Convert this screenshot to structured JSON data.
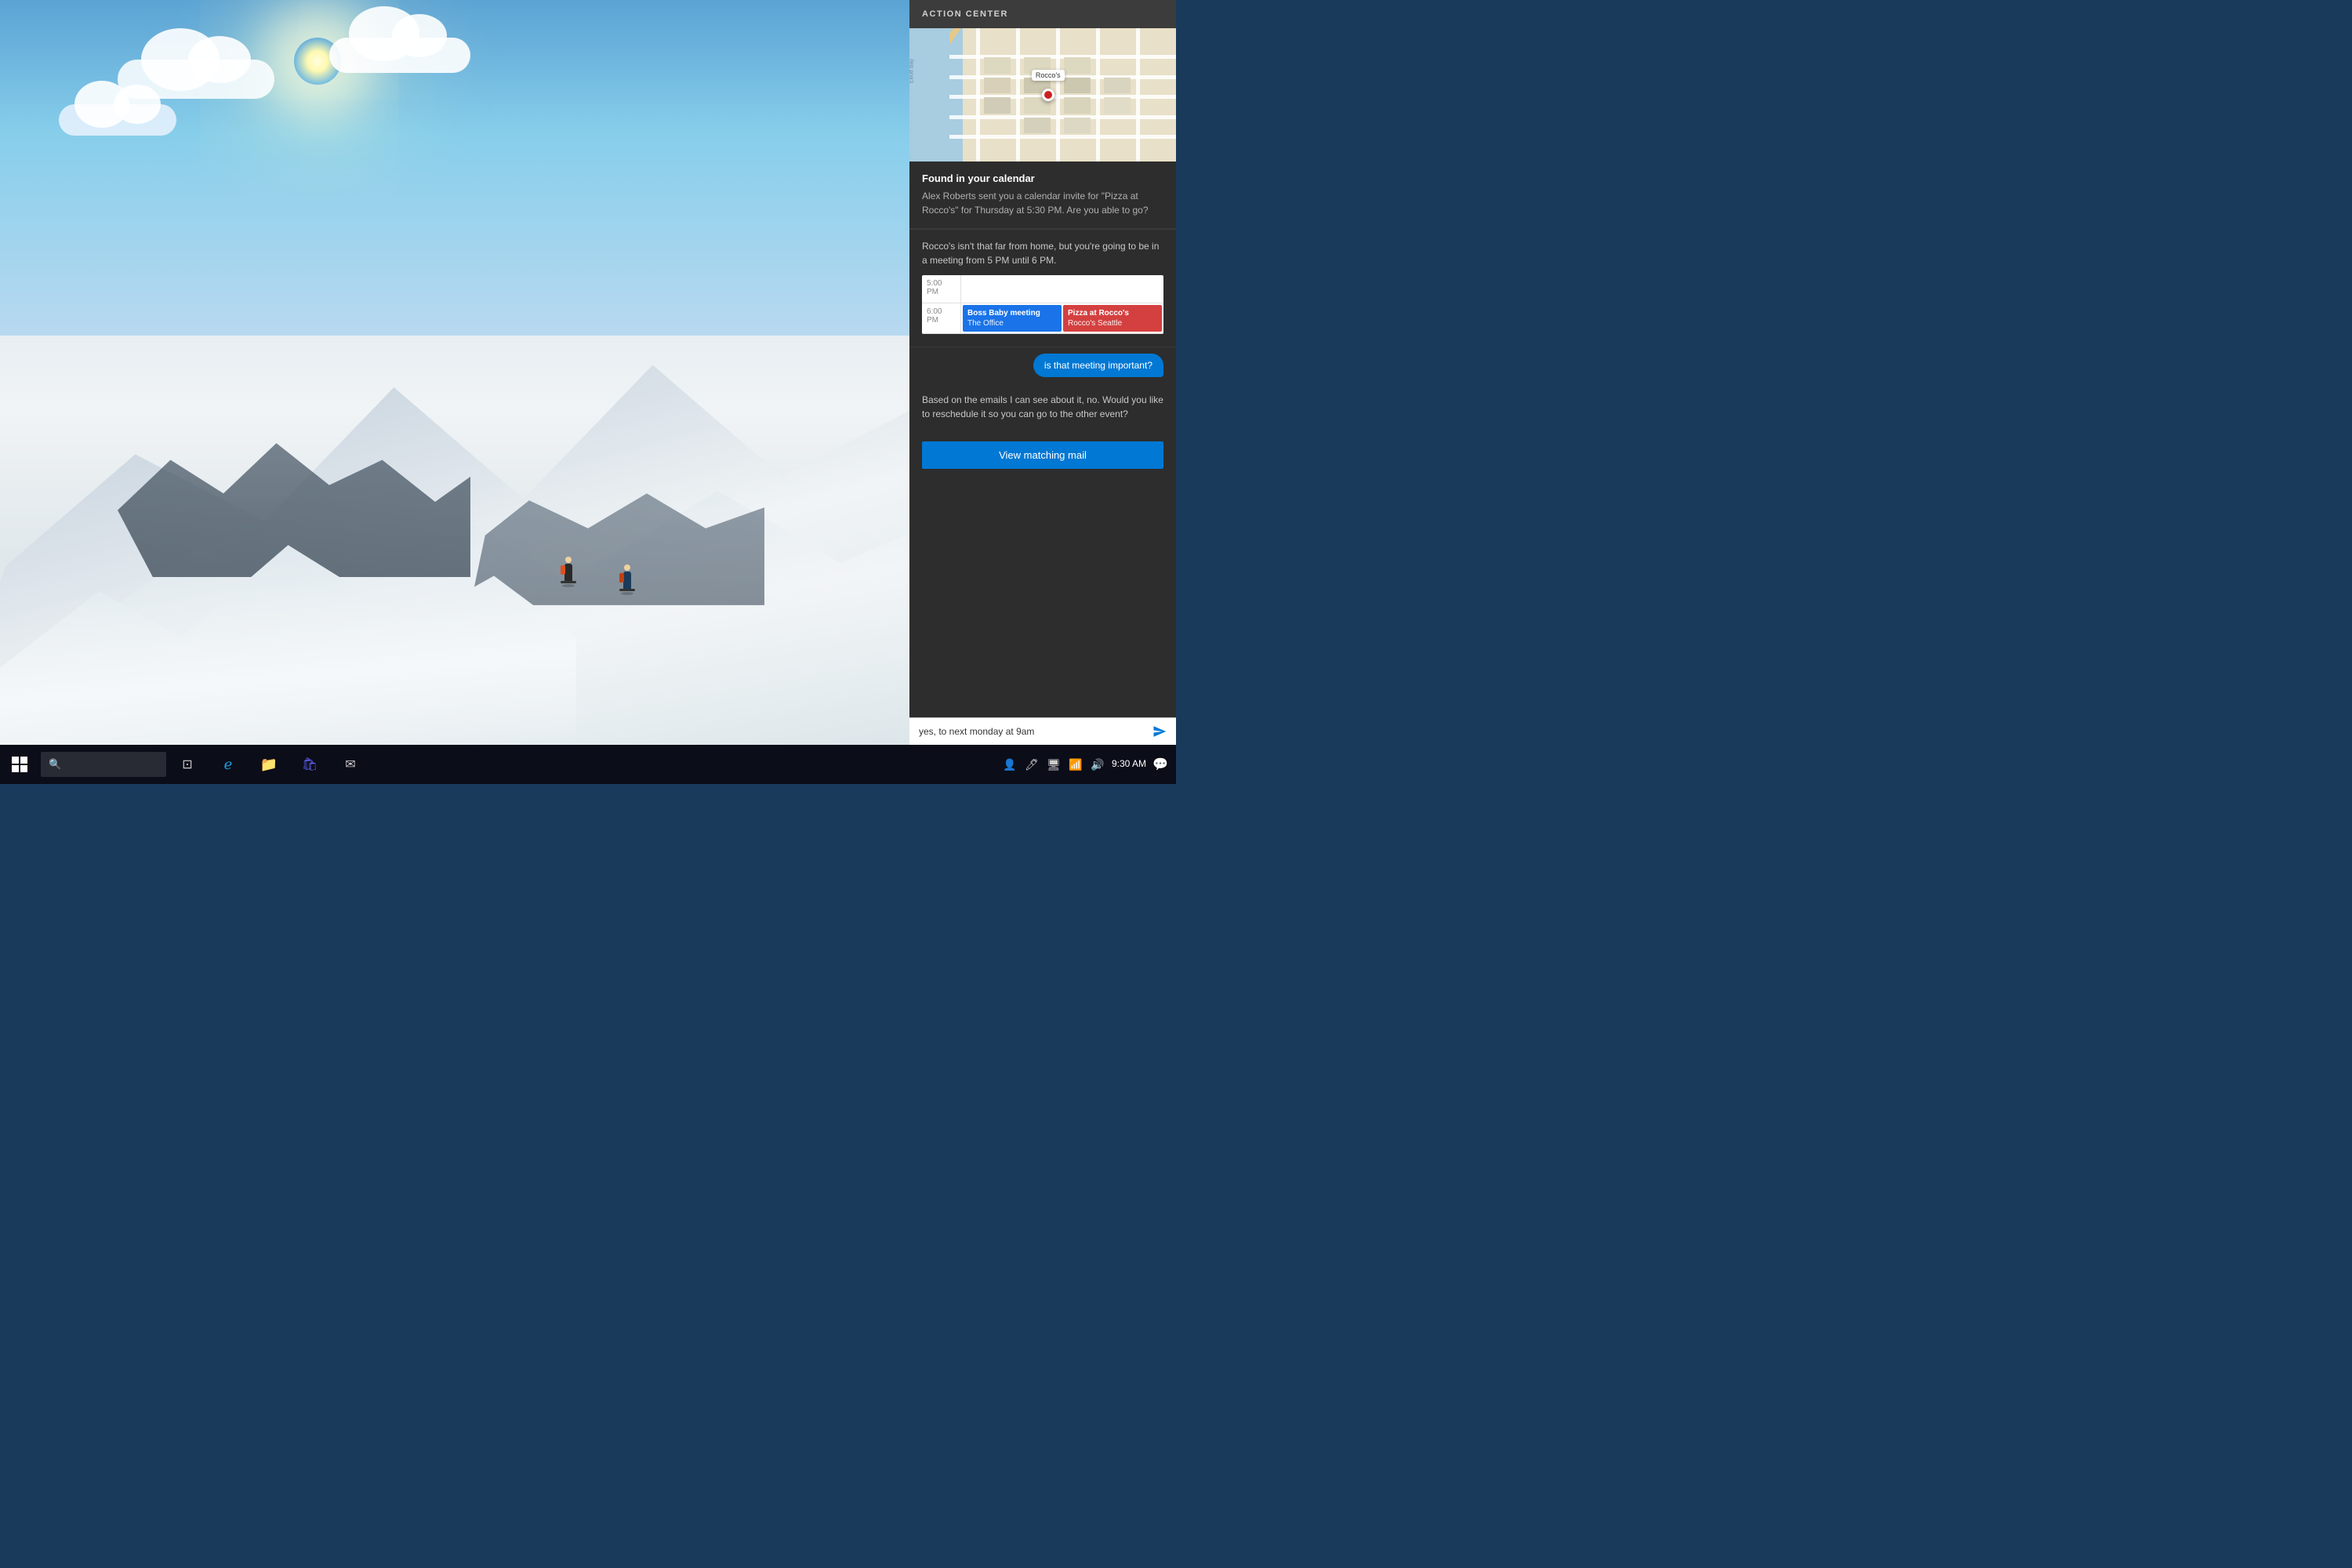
{
  "desktop": {
    "background": "winter mountain ski scene"
  },
  "taskbar": {
    "start_label": "Start",
    "search_placeholder": "Search",
    "time": "9:30 AM",
    "icons": [
      "task-view",
      "edge-browser",
      "file-explorer",
      "store",
      "mail"
    ]
  },
  "action_center": {
    "header": "ACTION CENTER",
    "map_alt": "Map showing Rocco's location in Seattle",
    "map_pin_label": "Rocco's",
    "notification": {
      "title": "Found in your calendar",
      "body": "Alex Roberts sent you a calendar invite for \"Pizza at Rocco's\" for Thursday at 5:30 PM. Are you able to go?"
    },
    "cortana_message1": "Rocco's isn't that far from home, but you're going to be in a meeting from 5 PM until 6 PM.",
    "calendar": {
      "rows": [
        {
          "time": "5:00 PM",
          "events": []
        },
        {
          "time": "6:00 PM",
          "events": [
            {
              "title": "Boss Baby meeting",
              "location": "The Office",
              "color": "blue"
            },
            {
              "title": "Pizza at Rocco's",
              "location": "Rocco's Seattle",
              "color": "red"
            }
          ]
        }
      ]
    },
    "user_bubble": "is that meeting important?",
    "cortana_response": "Based on the emails I can see about it, no. Would you like to reschedule it so you can go to the other event?",
    "view_mail_button": "View matching mail",
    "input_placeholder": "yes, to next monday at 9am",
    "send_label": "Send"
  }
}
